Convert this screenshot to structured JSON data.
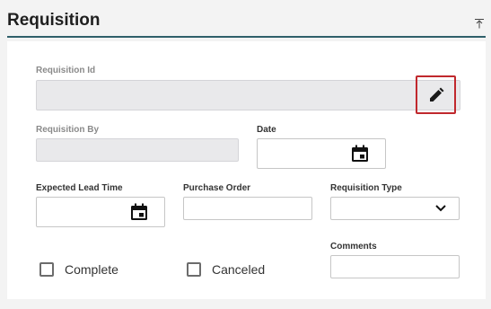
{
  "header": {
    "title": "Requisition"
  },
  "form": {
    "requisition_id": {
      "label": "Requisition Id",
      "value": ""
    },
    "requisition_by": {
      "label": "Requisition By",
      "value": ""
    },
    "date": {
      "label": "Date",
      "value": ""
    },
    "expected_lead_time": {
      "label": "Expected Lead Time",
      "value": ""
    },
    "purchase_order": {
      "label": "Purchase Order",
      "value": ""
    },
    "requisition_type": {
      "label": "Requisition Type",
      "value": ""
    },
    "comments": {
      "label": "Comments",
      "value": ""
    },
    "complete": {
      "label": "Complete",
      "checked": false
    },
    "canceled": {
      "label": "Canceled",
      "checked": false
    }
  },
  "icons": {
    "collapse": "collapse-up-icon",
    "edit": "pencil-icon",
    "calendar": "calendar-icon",
    "dropdown": "chevron-down-icon"
  },
  "colors": {
    "header_line": "#2f5f6a",
    "edit_border": "#c0282d"
  }
}
